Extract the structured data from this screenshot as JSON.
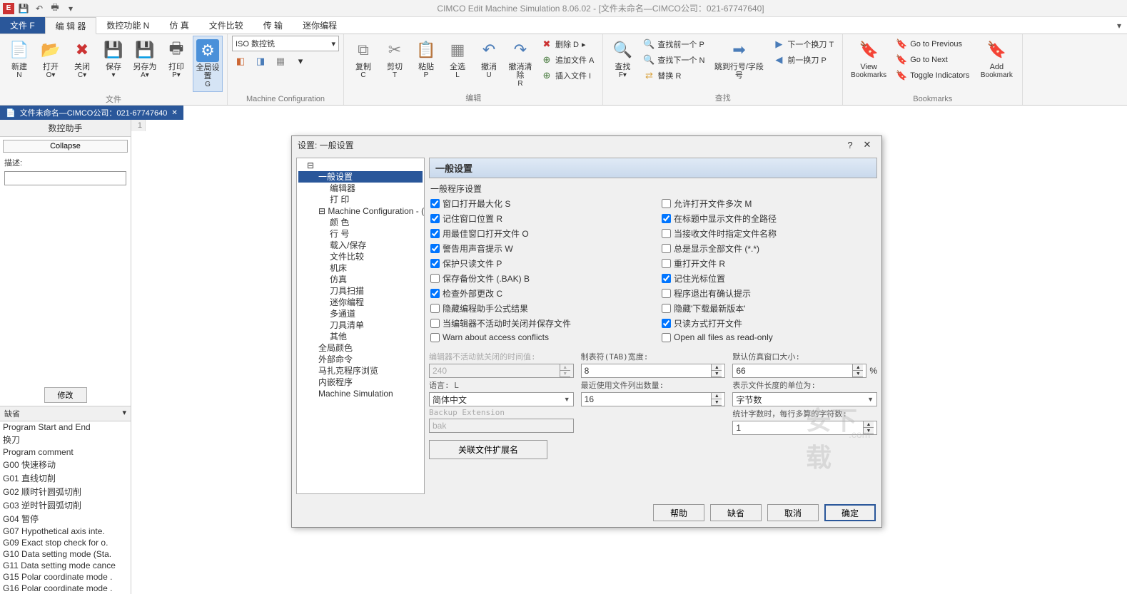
{
  "title": "CIMCO Edit Machine Simulation 8.06.02 - [文件未命名—CIMCO公司：021-67747640]",
  "ribbon_tabs": {
    "file": "文件 F",
    "editor": "编 辑 器",
    "nc": "数控功能 N",
    "sim": "仿  真",
    "compare": "文件比较",
    "transfer": "传 输",
    "mini": "迷你编程"
  },
  "ribbon": {
    "file_group": "文件",
    "new": "新建",
    "new_sub": "N",
    "open": "打开",
    "open_sub": "O▾",
    "close": "关闭",
    "close_sub": "C▾",
    "save": "保存",
    "save_sub": "▾",
    "saveas": "另存为",
    "saveas_sub": "A▾",
    "print": "打印",
    "print_sub": "P▾",
    "global": "全局设置",
    "global_sub": "G",
    "machine_conf": "Machine Configuration",
    "iso": "ISO 数控铣",
    "edit_group": "编辑",
    "copy": "复制",
    "copy_sub": "C",
    "cut": "剪切",
    "cut_sub": "T",
    "paste": "粘贴",
    "paste_sub": "P",
    "select": "全选",
    "select_sub": "L",
    "undo": "撤消",
    "undo_sub": "U",
    "redo": "撤消清除",
    "redo_sub": "R",
    "delete": "删除 D",
    "append": "追加文件 A",
    "insert": "插入文件 I",
    "find_group": "查找",
    "find": "查找",
    "find_sub": "F▾",
    "findprev": "查找前一个 P",
    "findnext": "查找下一个 N",
    "replace": "替换 R",
    "goto": "跳到行号/字段号",
    "nextswap": "下一个换刀 T",
    "prevswap": "前一换刀 P",
    "bookmarks_group": "Bookmarks",
    "viewbm": "View",
    "viewbm2": "Bookmarks",
    "gotoprev": "Go to Previous",
    "gotonext": "Go to Next",
    "toggleind": "Toggle Indicators",
    "addbm": "Add",
    "addbm2": "Bookmark"
  },
  "doc_tab": "文件未命名—CIMCO公司：021-67747640",
  "left": {
    "header": "数控助手",
    "collapse": "Collapse",
    "desc": "描述:",
    "modify": "修改",
    "default": "缺省",
    "items": [
      "Program Start and End",
      "换刀",
      "Program comment",
      "G00 快速移动",
      "G01 直线切削",
      "G02 顺时针圆弧切削",
      "G03 逆时针圆弧切削",
      "G04 暂停",
      "G07 Hypothetical axis inte.",
      "G09 Exact stop check for o.",
      "G10 Data setting mode (Sta.",
      "G11 Data setting mode cance",
      "G15 Polar coordinate mode .",
      "G16 Polar coordinate mode ."
    ]
  },
  "dialog": {
    "title": "设置: 一般设置",
    "help_q": "?",
    "close_x": "✕",
    "tree": {
      "general": "一般设置",
      "editor": "编辑器",
      "print": "打  印",
      "machine": "Machine Configuration - (IS",
      "color": "颜  色",
      "line": "行  号",
      "loadsave": "载入/保存",
      "filecmp": "文件比较",
      "machinetool": "机床",
      "sim": "仿真",
      "toolscan": "刀具扫描",
      "mini": "迷你编程",
      "multi": "多通道",
      "toollist": "刀具清单",
      "other": "其他",
      "globalcolor": "全局颜色",
      "extcmd": "外部命令",
      "mazak": "马扎克程序浏览",
      "embed": "内嵌程序",
      "msim": "Machine Simulation"
    },
    "right": {
      "header": "一般设置",
      "section": "一般程序设置",
      "left_checks": [
        {
          "label": "窗口打开最大化 S",
          "checked": true
        },
        {
          "label": "记住窗口位置 R",
          "checked": true
        },
        {
          "label": "用最佳窗口打开文件 O",
          "checked": true
        },
        {
          "label": "警告用声音提示 W",
          "checked": true
        },
        {
          "label": "保护只读文件 P",
          "checked": true
        },
        {
          "label": "保存备份文件 (.BAK) B",
          "checked": false
        },
        {
          "label": "检查外部更改 C",
          "checked": true
        },
        {
          "label": "隐藏编程助手公式结果",
          "checked": false
        },
        {
          "label": "当编辑器不活动时关闭并保存文件",
          "checked": false
        },
        {
          "label": "Warn about access conflicts",
          "checked": false
        }
      ],
      "right_checks": [
        {
          "label": "允许打开文件多次 M",
          "checked": false
        },
        {
          "label": "在标题中显示文件的全路径",
          "checked": true
        },
        {
          "label": "当接收文件时指定文件名称",
          "checked": false
        },
        {
          "label": "总是显示全部文件 (*.*)",
          "checked": false
        },
        {
          "label": "重打开文件 R",
          "checked": false
        },
        {
          "label": "记住光标位置",
          "checked": true
        },
        {
          "label": "程序退出有确认提示",
          "checked": false
        },
        {
          "label": "隐藏'下载最新版本'",
          "checked": false
        },
        {
          "label": "只读方式打开文件",
          "checked": true
        },
        {
          "label": "Open all files as read-only",
          "checked": false
        }
      ],
      "idle_label": "编辑器不活动就关闭的时间值:",
      "idle_value": "240",
      "lang_label": "语言: L",
      "lang_value": "简体中文",
      "backup_label": "Backup Extension",
      "backup_value": "bak",
      "tab_label": "制表符(TAB)宽度:",
      "tab_value": "8",
      "recent_label": "最近使用文件列出数量:",
      "recent_value": "16",
      "simwin_label": "默认仿真窗口大小:",
      "simwin_value": "66",
      "simwin_pct": "%",
      "lenunit_label": "表示文件长度的单位为:",
      "lenunit_value": "字节数",
      "charcount_label": "统计字数时，每行多算的字符数:",
      "charcount_value": "1",
      "assoc": "关联文件扩展名"
    },
    "buttons": {
      "help": "帮助",
      "default": "缺省",
      "cancel": "取消",
      "ok": "确定"
    }
  },
  "watermark": "安下载",
  "watermark2": ".com"
}
